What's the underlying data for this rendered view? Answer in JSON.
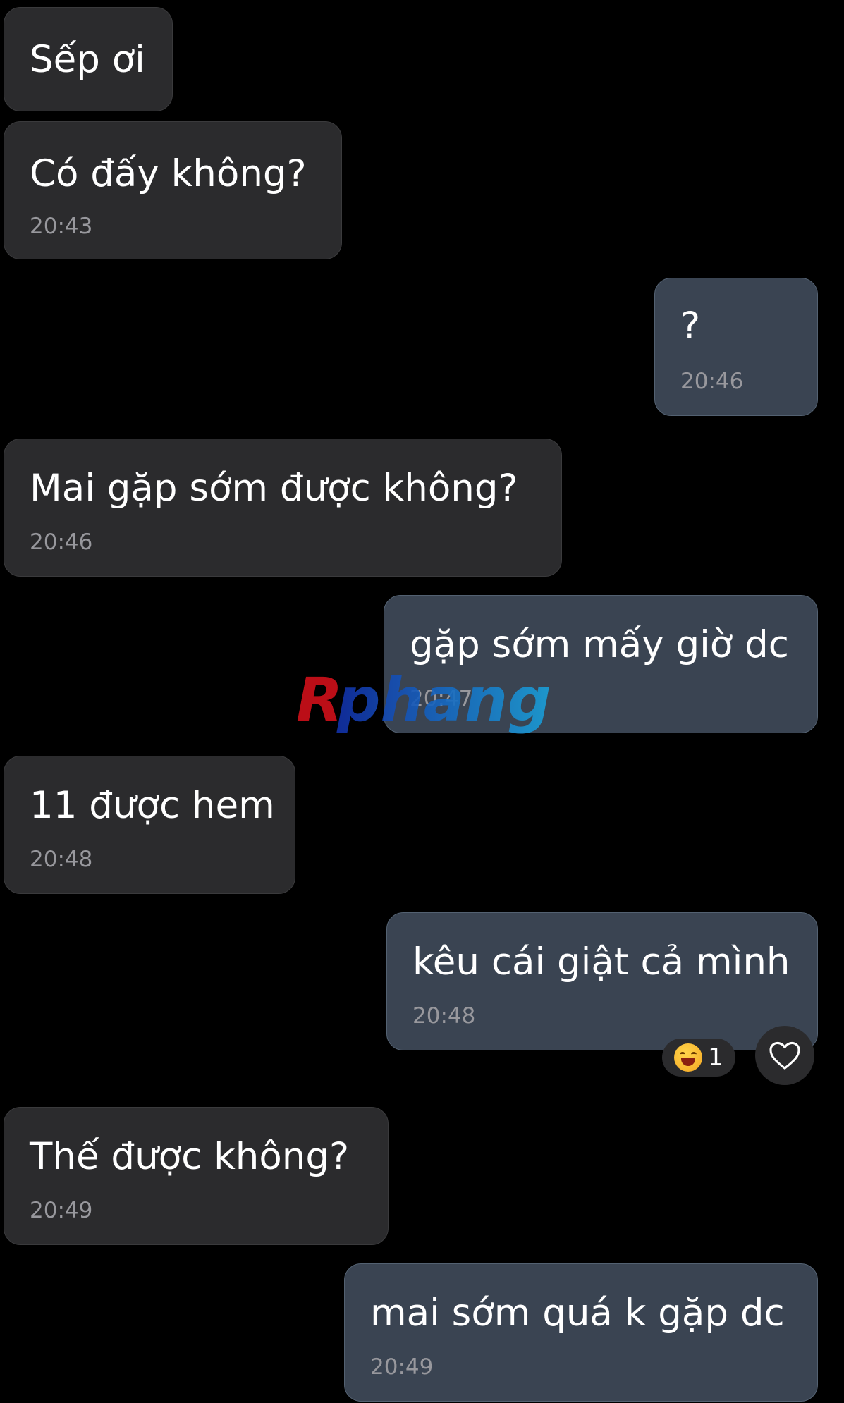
{
  "messages": [
    {
      "id": "m1",
      "direction": "in",
      "text": "Sếp ơi",
      "time": ""
    },
    {
      "id": "m2",
      "direction": "in",
      "text": "Có đấy không?",
      "time": "20:43"
    },
    {
      "id": "m3",
      "direction": "out",
      "text": "?",
      "time": "20:46"
    },
    {
      "id": "m4",
      "direction": "in",
      "text": "Mai gặp sớm được không?",
      "time": "20:46"
    },
    {
      "id": "m5",
      "direction": "out",
      "text": "gặp sớm mấy giờ dc",
      "time": "20:47"
    },
    {
      "id": "m6",
      "direction": "in",
      "text": "11 được hem",
      "time": "20:48"
    },
    {
      "id": "m7",
      "direction": "out",
      "text": "kêu cái giật cả mình",
      "time": "20:48"
    },
    {
      "id": "m8",
      "direction": "in",
      "text": "Thế được không?",
      "time": "20:49"
    },
    {
      "id": "m9",
      "direction": "out",
      "text": "mai sớm quá k gặp dc",
      "time": "20:49"
    }
  ],
  "reaction": {
    "emoji": "laughing-face",
    "count": "1"
  },
  "watermark": {
    "text": "Rphang"
  },
  "colors": {
    "background": "#000000",
    "incoming_bubble": "#2b2b2d",
    "outgoing_bubble": "#3a4452",
    "text": "#ffffff",
    "timestamp": "#98989d"
  }
}
